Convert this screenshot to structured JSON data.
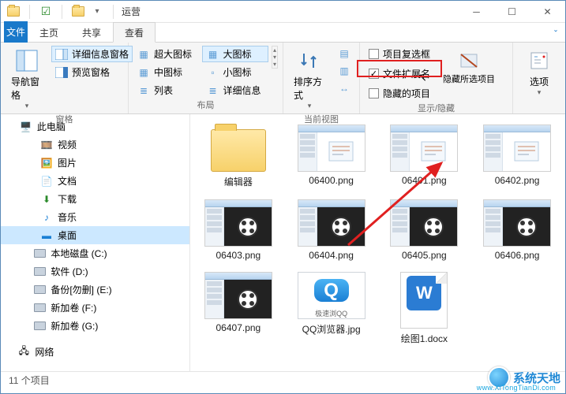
{
  "window": {
    "title": "运营"
  },
  "tabs": {
    "file": "文件",
    "home": "主页",
    "share": "共享",
    "view": "查看"
  },
  "ribbon": {
    "groups": {
      "panes": {
        "label": "窗格"
      },
      "layout": {
        "label": "布局"
      },
      "current_view": {
        "label": "当前视图"
      },
      "show_hide": {
        "label": "显示/隐藏"
      }
    },
    "nav_pane": "导航窗格",
    "details_pane": "详细信息窗格",
    "preview_pane": "预览窗格",
    "extra_large": "超大图标",
    "large": "大图标",
    "medium": "中图标",
    "small": "小图标",
    "list": "列表",
    "details": "详细信息",
    "sort_by": "排序方式",
    "item_checkboxes": "项目复选框",
    "file_ext": "文件扩展名",
    "hidden_items": "隐藏的项目",
    "hide_selected": "隐藏所选项目",
    "options": "选项"
  },
  "tree": {
    "this_pc": "此电脑",
    "videos": "视频",
    "pictures": "图片",
    "documents": "文档",
    "downloads": "下载",
    "music": "音乐",
    "desktop": "桌面",
    "local_c": "本地磁盘 (C:)",
    "soft_d": "软件 (D:)",
    "backup_e": "备份[勿删] (E:)",
    "new_f": "新加卷 (F:)",
    "new_g": "新加卷 (G:)",
    "network": "网络"
  },
  "files": [
    {
      "name": "编辑器",
      "kind": "folder"
    },
    {
      "name": "06400.png",
      "kind": "img"
    },
    {
      "name": "06401.png",
      "kind": "img"
    },
    {
      "name": "06402.png",
      "kind": "img"
    },
    {
      "name": "06403.png",
      "kind": "img-vid"
    },
    {
      "name": "06404.png",
      "kind": "img-vid"
    },
    {
      "name": "06405.png",
      "kind": "img-vid"
    },
    {
      "name": "06406.png",
      "kind": "img-vid"
    },
    {
      "name": "06407.png",
      "kind": "img-vid"
    },
    {
      "name": "QQ浏览器.jpg",
      "kind": "qq"
    },
    {
      "name": "绘图1.docx",
      "kind": "docx"
    }
  ],
  "qq_caption": "极速浏QQ",
  "status": {
    "count": "11 个项目"
  },
  "watermark": {
    "name": "系统天地",
    "url": "www.XiTongTianDi.com"
  }
}
